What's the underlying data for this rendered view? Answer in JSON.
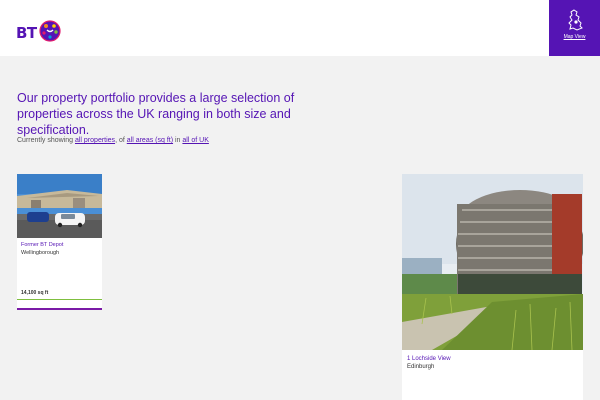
{
  "header": {
    "logo_text": "BT",
    "map_view_label": "Map View",
    "colors": {
      "brand": "#5514b4"
    }
  },
  "main": {
    "headline": "Our property portfolio provides a large selection of properties across the UK ranging in both size and specification.",
    "filter": {
      "prefix": "Currently showing",
      "type_link": "all properties",
      "of_text": ", of",
      "area_link": "all areas (sq ft)",
      "in_text": "in",
      "location_link": "all of UK"
    }
  },
  "properties": [
    {
      "name": "Former BT Depot",
      "city": "Wellingborough",
      "size": "14,100 sq ft"
    },
    {
      "name": "1 Lochside View",
      "city": "Edinburgh"
    }
  ]
}
